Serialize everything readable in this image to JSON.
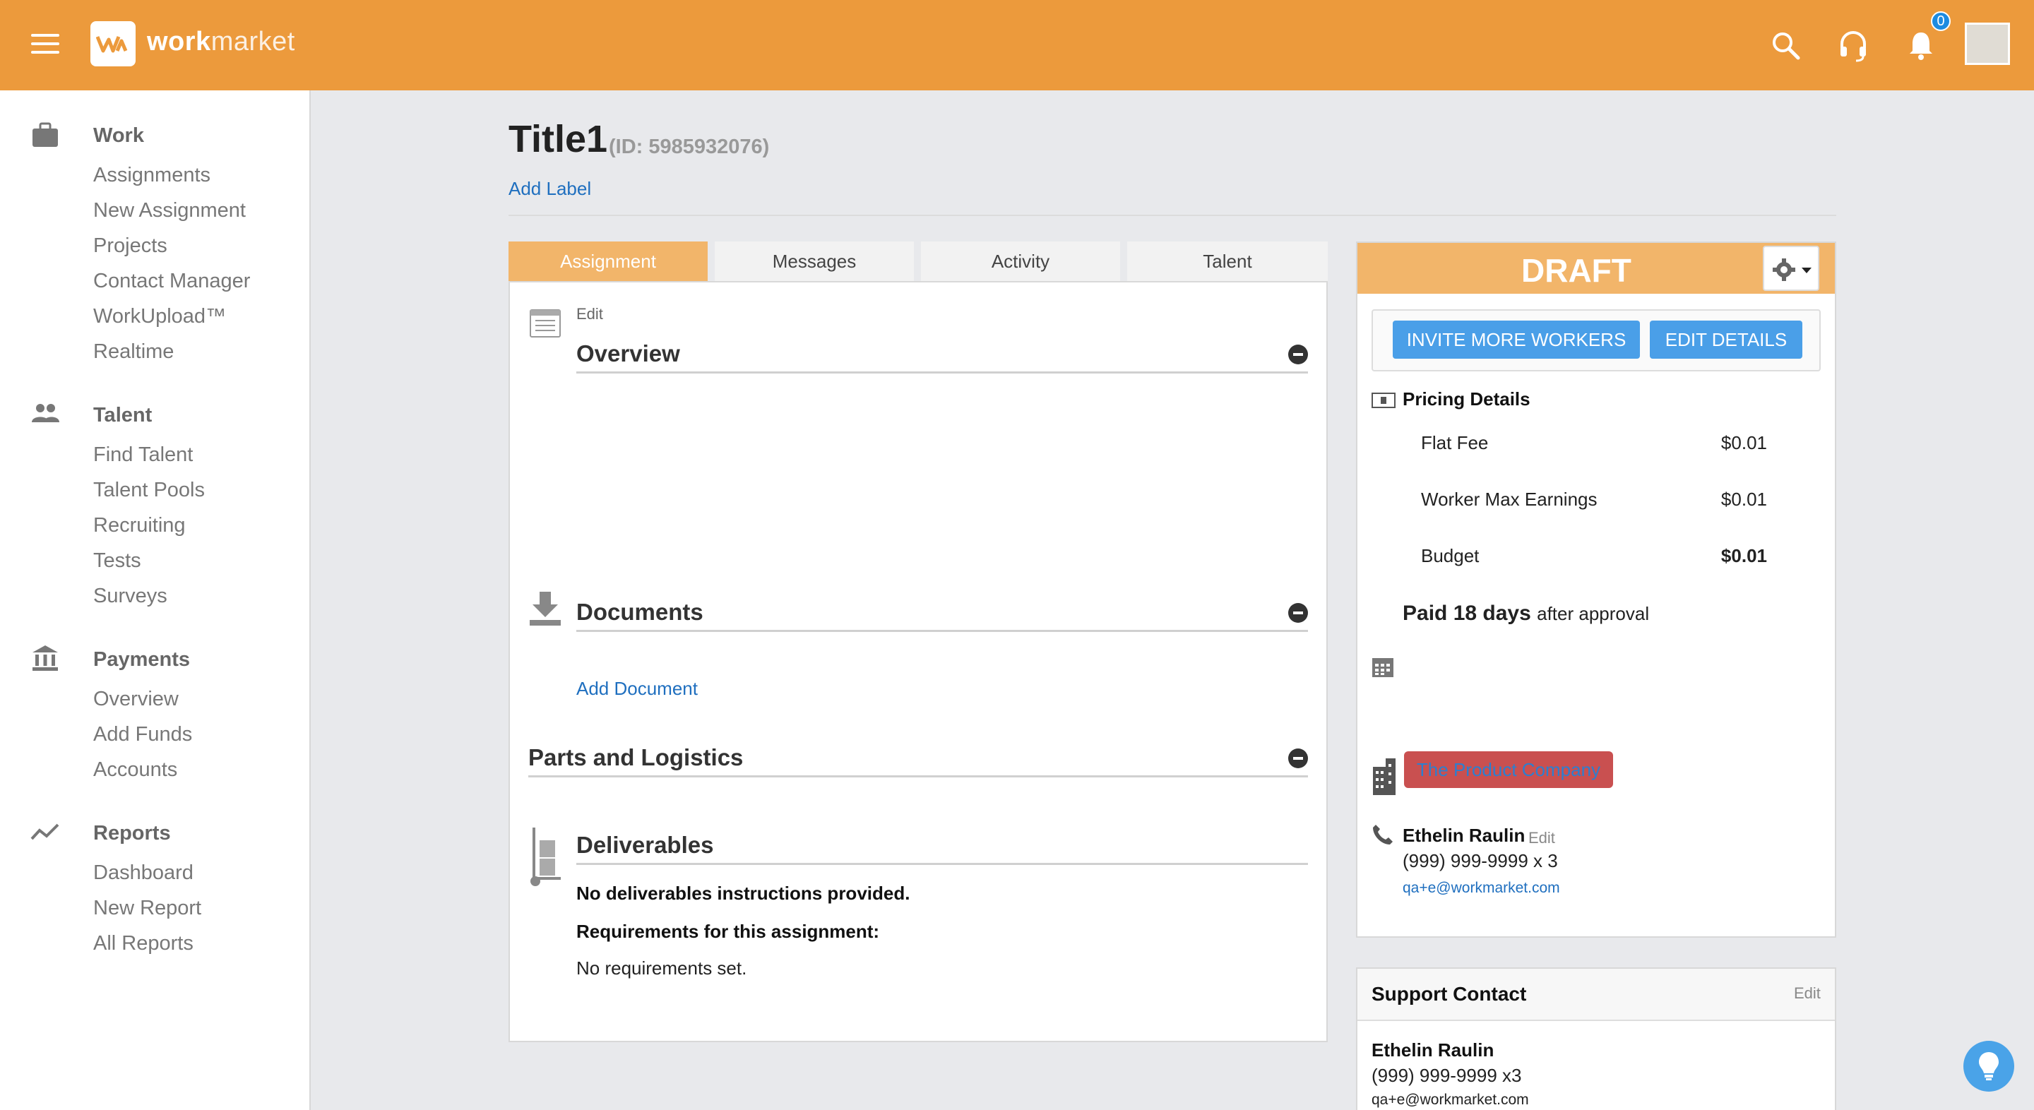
{
  "header": {
    "brand_bold": "work",
    "brand_light": "market",
    "notification_count": "0",
    "icons": [
      "menu-icon",
      "search-icon",
      "headset-icon",
      "bell-icon"
    ]
  },
  "sidebar": {
    "sections": [
      {
        "heading": "Work",
        "icon": "briefcase-icon",
        "items": [
          "Assignments",
          "New Assignment",
          "Projects",
          "Contact Manager",
          "WorkUpload™",
          "Realtime"
        ]
      },
      {
        "heading": "Talent",
        "icon": "people-icon",
        "items": [
          "Find Talent",
          "Talent Pools",
          "Recruiting",
          "Tests",
          "Surveys"
        ]
      },
      {
        "heading": "Payments",
        "icon": "bank-icon",
        "items": [
          "Overview",
          "Add Funds",
          "Accounts"
        ]
      },
      {
        "heading": "Reports",
        "icon": "trend-icon",
        "items": [
          "Dashboard",
          "New Report",
          "All Reports"
        ]
      }
    ]
  },
  "page": {
    "title": "Title1",
    "id_text": "(ID: 5985932076)",
    "add_label": "Add Label"
  },
  "tabs": [
    "Assignment",
    "Messages",
    "Activity",
    "Talent"
  ],
  "assignment": {
    "overview_edit": "Edit",
    "overview_title": "Overview",
    "documents_title": "Documents",
    "add_document": "Add Document",
    "parts_title": "Parts and Logistics",
    "deliverables_title": "Deliverables",
    "no_deliverables": "No deliverables instructions provided.",
    "requirements_heading": "Requirements for this assignment:",
    "no_requirements": "No requirements set."
  },
  "status": {
    "label": "DRAFT",
    "invite_button": "INVITE MORE WORKERS",
    "edit_button": "EDIT DETAILS",
    "pricing_title": "Pricing Details",
    "flat_fee_label": "Flat Fee",
    "flat_fee_value": "$0.01",
    "max_earnings_label": "Worker Max Earnings",
    "max_earnings_value": "$0.01",
    "budget_label": "Budget",
    "budget_value": "$0.01",
    "paid_bold": "Paid 18 days",
    "paid_rest": "after approval",
    "company": "The Product Company",
    "contact_name": "Ethelin Raulin",
    "contact_edit": "Edit",
    "contact_phone": "(999) 999-9999 x 3",
    "contact_email": "qa+e@workmarket.com"
  },
  "support": {
    "title": "Support Contact",
    "edit": "Edit",
    "name": "Ethelin Raulin",
    "phone": "(999) 999-9999 x3",
    "email": "qa+e@workmarket.com"
  },
  "colors": {
    "header": "#ec9a3c",
    "tab_active": "#f2b56a",
    "button_blue": "#4a9fe8",
    "link": "#1f6fbf",
    "company_badge": "#c95050"
  }
}
